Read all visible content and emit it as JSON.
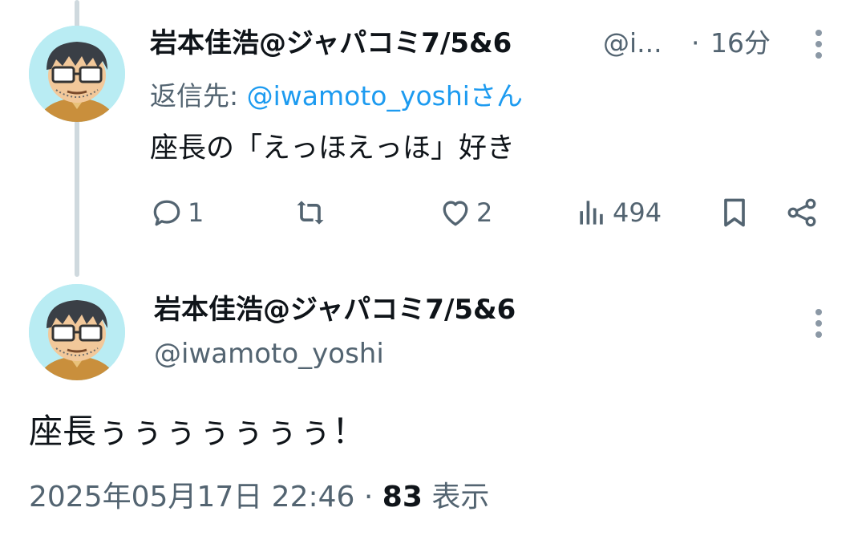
{
  "reply_tweet": {
    "display_name": "岩本佳浩@ジャパコミ7/5&6",
    "handle_truncated": "@i...",
    "time_separator": "·",
    "time_ago": "16分",
    "reply_prefix": "返信先: ",
    "reply_mention": "@iwamoto_yoshiさん",
    "text": "座長の「えっほえっほ」好き",
    "actions": {
      "reply_count": "1",
      "retweet_count": "",
      "like_count": "2",
      "views_count": "494"
    }
  },
  "main_tweet": {
    "display_name": "岩本佳浩@ジャパコミ7/5&6",
    "handle": "@iwamoto_yoshi",
    "text": "座長ぅぅぅぅぅぅぅ！",
    "date": "2025年05月17日 22:46",
    "separator": " · ",
    "views_count": "83",
    "views_label": " 表示"
  },
  "colors": {
    "text_primary": "#0f1419",
    "text_secondary": "#536471",
    "link": "#1d9bf0",
    "thread_line": "#cfd9de",
    "avatar_bg": "#b9ecf3"
  },
  "icons": [
    "reply-icon",
    "retweet-icon",
    "like-icon",
    "views-icon",
    "bookmark-icon",
    "share-icon",
    "more-icon"
  ]
}
